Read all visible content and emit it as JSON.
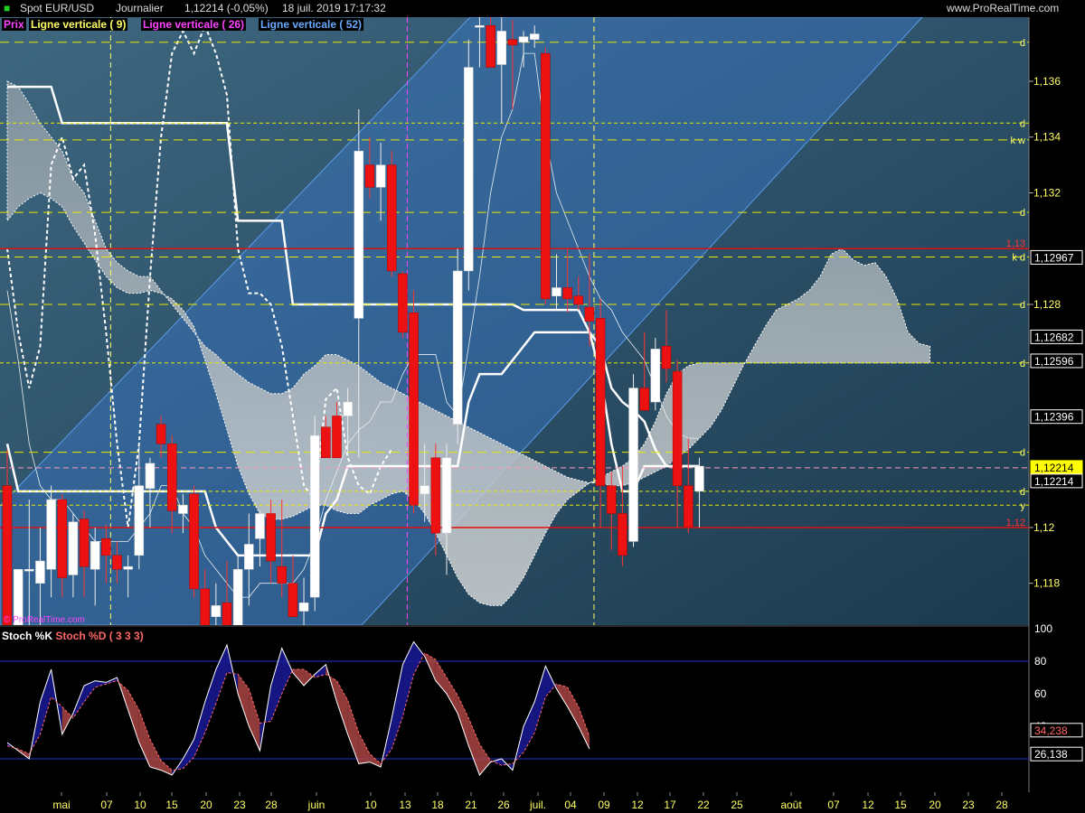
{
  "header": {
    "instrument": "Spot EUR/USD",
    "period": "Journalier",
    "quote": "1,12214 (-0,05%)",
    "datetime": "18 juil. 2019 17:17:32",
    "site": "www.ProRealTime.com"
  },
  "watermark": "© ProRealTime.com",
  "legend": [
    {
      "label": "Prix",
      "color": "#ff44ff"
    },
    {
      "label": "Ligne verticale ( 9)",
      "color": "#ffff66"
    },
    {
      "label": "Ligne verticale ( 26)",
      "color": "#ff44ff"
    },
    {
      "label": "Ligne verticale ( 52)",
      "color": "#66aaff"
    }
  ],
  "colors": {
    "up": "#ffffff",
    "down": "#ee1111",
    "channel": "#3a78c8",
    "stoch_k": "#ffffff",
    "stoch_d": "#ff6666",
    "level_line": "#e8e800",
    "red_line": "#dd1111"
  },
  "chart_data": [
    {
      "type": "candlestick",
      "ylim": [
        1.1165,
        1.1383
      ],
      "y_ticks": [
        1.118,
        1.12,
        1.128,
        1.132,
        1.134,
        1.136
      ],
      "y_tick_labels": [
        "1,118",
        "1,12",
        "1,128",
        "1,132",
        "1,134",
        "1,136"
      ],
      "x_labels": [
        "mai",
        "07",
        "10",
        "15",
        "20",
        "23",
        "28",
        "juin",
        "10",
        "13",
        "18",
        "21",
        "26",
        "juil.",
        "04",
        "09",
        "12",
        "17",
        "22",
        "25",
        "août",
        "07",
        "12",
        "15",
        "20",
        "23",
        "28"
      ],
      "candles": [
        {
          "o": 1.1215,
          "h": 1.1228,
          "l": 1.1165,
          "c": 1.1165
        },
        {
          "o": 1.1165,
          "h": 1.1185,
          "l": 1.1165,
          "c": 1.1185
        },
        {
          "o": 1.1185,
          "h": 1.121,
          "l": 1.1165,
          "c": 1.1185
        },
        {
          "o": 1.118,
          "h": 1.12,
          "l": 1.1165,
          "c": 1.1188
        },
        {
          "o": 1.1185,
          "h": 1.1215,
          "l": 1.1175,
          "c": 1.121
        },
        {
          "o": 1.121,
          "h": 1.1212,
          "l": 1.1175,
          "c": 1.1182
        },
        {
          "o": 1.1183,
          "h": 1.1205,
          "l": 1.1175,
          "c": 1.1202
        },
        {
          "o": 1.1203,
          "h": 1.1206,
          "l": 1.1175,
          "c": 1.1186
        },
        {
          "o": 1.1185,
          "h": 1.12,
          "l": 1.1172,
          "c": 1.1195
        },
        {
          "o": 1.1196,
          "h": 1.1201,
          "l": 1.118,
          "c": 1.119
        },
        {
          "o": 1.119,
          "h": 1.1195,
          "l": 1.118,
          "c": 1.1185
        },
        {
          "o": 1.1185,
          "h": 1.119,
          "l": 1.1175,
          "c": 1.1186
        },
        {
          "o": 1.119,
          "h": 1.123,
          "l": 1.1185,
          "c": 1.1215
        },
        {
          "o": 1.1214,
          "h": 1.1225,
          "l": 1.12,
          "c": 1.1223
        },
        {
          "o": 1.1237,
          "h": 1.124,
          "l": 1.1225,
          "c": 1.123
        },
        {
          "o": 1.123,
          "h": 1.1233,
          "l": 1.1198,
          "c": 1.1206
        },
        {
          "o": 1.1205,
          "h": 1.1212,
          "l": 1.1198,
          "c": 1.1208
        },
        {
          "o": 1.1212,
          "h": 1.1215,
          "l": 1.1175,
          "c": 1.1178
        },
        {
          "o": 1.1178,
          "h": 1.1185,
          "l": 1.1155,
          "c": 1.116
        },
        {
          "o": 1.1168,
          "h": 1.118,
          "l": 1.116,
          "c": 1.1172
        },
        {
          "o": 1.1173,
          "h": 1.1188,
          "l": 1.116,
          "c": 1.1163
        },
        {
          "o": 1.1161,
          "h": 1.119,
          "l": 1.1155,
          "c": 1.1185
        },
        {
          "o": 1.1185,
          "h": 1.1205,
          "l": 1.1172,
          "c": 1.1194
        },
        {
          "o": 1.1196,
          "h": 1.1206,
          "l": 1.1186,
          "c": 1.1205
        },
        {
          "o": 1.1205,
          "h": 1.121,
          "l": 1.118,
          "c": 1.1188
        },
        {
          "o": 1.1186,
          "h": 1.121,
          "l": 1.1175,
          "c": 1.118
        },
        {
          "o": 1.118,
          "h": 1.119,
          "l": 1.1168,
          "c": 1.1168
        },
        {
          "o": 1.117,
          "h": 1.1182,
          "l": 1.116,
          "c": 1.1173
        },
        {
          "o": 1.1175,
          "h": 1.124,
          "l": 1.117,
          "c": 1.1233
        },
        {
          "o": 1.1236,
          "h": 1.124,
          "l": 1.1228,
          "c": 1.1225
        },
        {
          "o": 1.124,
          "h": 1.1245,
          "l": 1.1225,
          "c": 1.1225
        },
        {
          "o": 1.124,
          "h": 1.125,
          "l": 1.1226,
          "c": 1.1245
        },
        {
          "o": 1.1275,
          "h": 1.135,
          "l": 1.1225,
          "c": 1.1335
        },
        {
          "o": 1.133,
          "h": 1.134,
          "l": 1.1318,
          "c": 1.1322
        },
        {
          "o": 1.1322,
          "h": 1.1338,
          "l": 1.131,
          "c": 1.133
        },
        {
          "o": 1.133,
          "h": 1.1335,
          "l": 1.129,
          "c": 1.1292
        },
        {
          "o": 1.1291,
          "h": 1.1292,
          "l": 1.1268,
          "c": 1.127
        },
        {
          "o": 1.1277,
          "h": 1.1285,
          "l": 1.1205,
          "c": 1.1208
        },
        {
          "o": 1.1212,
          "h": 1.123,
          "l": 1.1202,
          "c": 1.1215
        },
        {
          "o": 1.1225,
          "h": 1.123,
          "l": 1.119,
          "c": 1.1198
        },
        {
          "o": 1.1198,
          "h": 1.123,
          "l": 1.1183,
          "c": 1.1225
        },
        {
          "o": 1.1237,
          "h": 1.13,
          "l": 1.123,
          "c": 1.1292
        },
        {
          "o": 1.1292,
          "h": 1.1375,
          "l": 1.1285,
          "c": 1.1365
        },
        {
          "o": 1.138,
          "h": 1.1385,
          "l": 1.1365,
          "c": 1.138
        },
        {
          "o": 1.138,
          "h": 1.1385,
          "l": 1.1365,
          "c": 1.1365
        },
        {
          "o": 1.1366,
          "h": 1.1385,
          "l": 1.1345,
          "c": 1.1378
        },
        {
          "o": 1.1375,
          "h": 1.1382,
          "l": 1.135,
          "c": 1.1373
        },
        {
          "o": 1.1374,
          "h": 1.1378,
          "l": 1.1365,
          "c": 1.1376
        },
        {
          "o": 1.1375,
          "h": 1.138,
          "l": 1.1372,
          "c": 1.1377
        },
        {
          "o": 1.137,
          "h": 1.1372,
          "l": 1.128,
          "c": 1.1282
        },
        {
          "o": 1.1283,
          "h": 1.1298,
          "l": 1.1278,
          "c": 1.1286
        },
        {
          "o": 1.1286,
          "h": 1.13,
          "l": 1.1277,
          "c": 1.1282
        },
        {
          "o": 1.1283,
          "h": 1.129,
          "l": 1.1278,
          "c": 1.128
        },
        {
          "o": 1.1279,
          "h": 1.1298,
          "l": 1.1265,
          "c": 1.1274
        },
        {
          "o": 1.1275,
          "h": 1.1282,
          "l": 1.12,
          "c": 1.1215
        },
        {
          "o": 1.1215,
          "h": 1.122,
          "l": 1.1192,
          "c": 1.1205
        },
        {
          "o": 1.1205,
          "h": 1.1222,
          "l": 1.1186,
          "c": 1.119
        },
        {
          "o": 1.1195,
          "h": 1.1255,
          "l": 1.1193,
          "c": 1.125
        },
        {
          "o": 1.125,
          "h": 1.127,
          "l": 1.1242,
          "c": 1.1242
        },
        {
          "o": 1.1245,
          "h": 1.1268,
          "l": 1.1242,
          "c": 1.1264
        },
        {
          "o": 1.1265,
          "h": 1.1278,
          "l": 1.1252,
          "c": 1.1257
        },
        {
          "o": 1.1256,
          "h": 1.126,
          "l": 1.12,
          "c": 1.1215
        },
        {
          "o": 1.1215,
          "h": 1.1232,
          "l": 1.1198,
          "c": 1.12
        },
        {
          "o": 1.1213,
          "h": 1.1225,
          "l": 1.12,
          "c": 1.1222
        }
      ],
      "price_labels": [
        {
          "value": 1.12967,
          "label": "1,12967",
          "style": "black"
        },
        {
          "value": 1.12682,
          "label": "1,12682",
          "style": "black"
        },
        {
          "value": 1.12596,
          "label": "1,12596",
          "style": "black"
        },
        {
          "value": 1.12396,
          "label": "1,12396",
          "style": "black"
        },
        {
          "value": 1.12214,
          "label": "1,12214",
          "style": "yellow"
        },
        {
          "value": 1.12214,
          "label": "1,12214",
          "style": "black-offset"
        }
      ],
      "levels": [
        {
          "value": 1.1374,
          "tag": "d",
          "dash": "long"
        },
        {
          "value": 1.1345,
          "tag": "d",
          "dash": "short"
        },
        {
          "value": 1.1339,
          "tag": "k w",
          "dash": "long"
        },
        {
          "value": 1.1313,
          "tag": "d",
          "dash": "long"
        },
        {
          "value": 1.1297,
          "tag": "k d",
          "dash": "long"
        },
        {
          "value": 1.128,
          "tag": "d",
          "dash": "long"
        },
        {
          "value": 1.1259,
          "tag": "d",
          "dash": "short"
        },
        {
          "value": 1.1227,
          "tag": "d",
          "dash": "long"
        },
        {
          "value": 1.1213,
          "tag": "d",
          "dash": "short"
        },
        {
          "value": 1.1208,
          "tag": "y",
          "dash": "short"
        }
      ],
      "red_levels": [
        {
          "value": 1.13,
          "label": "1,13"
        },
        {
          "value": 1.12,
          "label": "1,12"
        }
      ]
    },
    {
      "type": "line",
      "legend": [
        "Stoch %K",
        "Stoch %D ( 3 3 3)"
      ],
      "ylim": [
        0,
        100
      ],
      "y_ticks": [
        40,
        60,
        80,
        100
      ],
      "hlines": [
        80,
        20
      ],
      "last_labels": [
        {
          "label": "34,238",
          "series": "d"
        },
        {
          "label": "26,138",
          "series": "k"
        }
      ],
      "k": [
        30,
        25,
        20,
        55,
        75,
        35,
        48,
        65,
        68,
        67,
        70,
        50,
        30,
        15,
        13,
        10,
        20,
        32,
        55,
        75,
        90,
        60,
        40,
        25,
        65,
        88,
        73,
        65,
        72,
        78,
        55,
        35,
        17,
        18,
        15,
        45,
        78,
        92,
        83,
        68,
        60,
        48,
        28,
        10,
        18,
        20,
        13,
        40,
        55,
        77,
        63,
        52,
        40,
        26
      ],
      "d": [
        28,
        26,
        23,
        35,
        58,
        52,
        45,
        55,
        64,
        66,
        68,
        62,
        50,
        32,
        19,
        13,
        14,
        21,
        36,
        54,
        73,
        72,
        63,
        42,
        43,
        60,
        75,
        75,
        70,
        72,
        68,
        56,
        36,
        23,
        17,
        26,
        46,
        72,
        85,
        81,
        70,
        59,
        45,
        29,
        19,
        16,
        17,
        24,
        36,
        58,
        66,
        64,
        52,
        34
      ]
    }
  ]
}
